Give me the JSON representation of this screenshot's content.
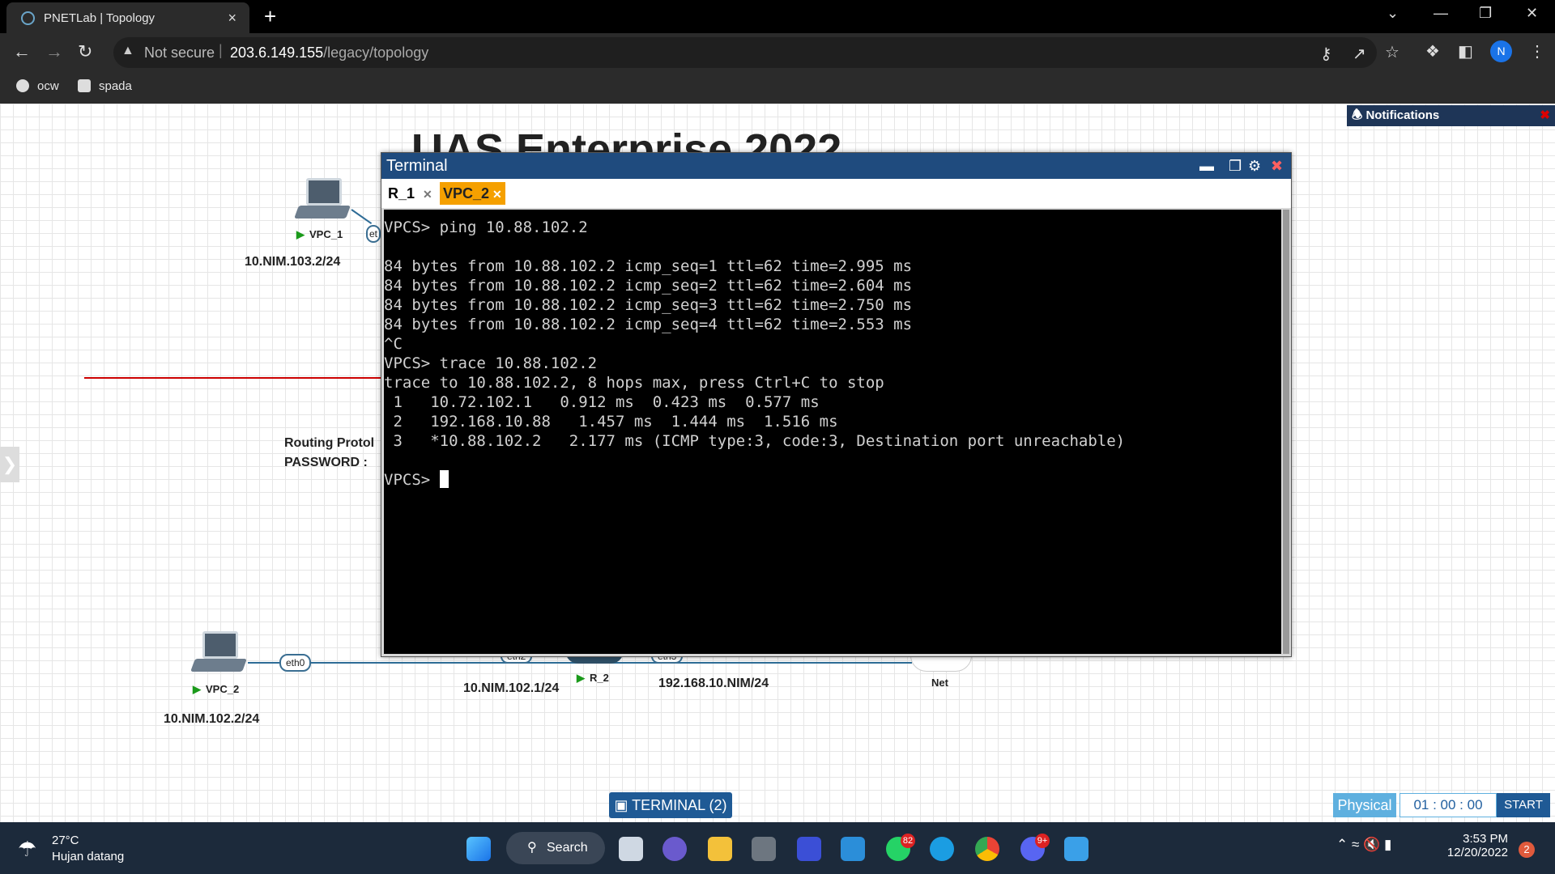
{
  "browser": {
    "tab_title": "PNETLab | Topology",
    "tab_close": "×",
    "new_tab": "+",
    "security_label": "Not secure",
    "url_host": "203.6.149.155",
    "url_path": "/legacy/topology",
    "profile_initial": "N",
    "bookmarks": [
      {
        "label": "ocw"
      },
      {
        "label": "spada"
      }
    ]
  },
  "topology": {
    "title": "UAS Enterprise 2022",
    "notifications_label": "Notifications",
    "nodes": {
      "vpc1": {
        "name": "VPC_1",
        "ip": "10.NIM.103.2/24",
        "iface": "et"
      },
      "vpc2": {
        "name": "VPC_2",
        "ip": "10.NIM.102.2/24",
        "iface": "eth0"
      },
      "r2": {
        "name": "R_2",
        "ip_eth2": "10.NIM.102.1/24",
        "ip_eth3": "192.168.10.NIM/24",
        "iface_a": "eth2",
        "iface_b": "eth3"
      },
      "net": {
        "name": "Net"
      }
    },
    "text_box": {
      "line1": "Routing Protol",
      "line2": "PASSWORD :"
    }
  },
  "terminal": {
    "window_title": "Terminal",
    "tabs": [
      {
        "label": "R_1",
        "active": false
      },
      {
        "label": "VPC_2",
        "active": true
      }
    ],
    "lines": [
      "VPCS> ping 10.88.102.2",
      "",
      "84 bytes from 10.88.102.2 icmp_seq=1 ttl=62 time=2.995 ms",
      "84 bytes from 10.88.102.2 icmp_seq=2 ttl=62 time=2.604 ms",
      "84 bytes from 10.88.102.2 icmp_seq=3 ttl=62 time=2.750 ms",
      "84 bytes from 10.88.102.2 icmp_seq=4 ttl=62 time=2.553 ms",
      "^C",
      "VPCS> trace 10.88.102.2",
      "trace to 10.88.102.2, 8 hops max, press Ctrl+C to stop",
      " 1   10.72.102.1   0.912 ms  0.423 ms  0.577 ms",
      " 2   192.168.10.88   1.457 ms  1.444 ms  1.516 ms",
      " 3   *10.88.102.2   2.177 ms (ICMP type:3, code:3, Destination port unreachable)",
      ""
    ],
    "prompt": "VPCS> "
  },
  "controls": {
    "terminal_button": "TERMINAL (2)",
    "physical_label": "Physical",
    "timer": "01 : 00 : 00",
    "start_label": "START"
  },
  "taskbar": {
    "temperature": "27°C",
    "weather": "Hujan datang",
    "search_label": "Search",
    "whatsapp_badge": "82",
    "discord_badge": "9+",
    "time": "3:53 PM",
    "date": "12/20/2022",
    "notification_count": "2"
  },
  "colors": {
    "terminal_title_bar": "#1f4b7e",
    "active_tab": "#f5a000",
    "link": "#2e6c96",
    "accent_button": "#1f5a95"
  }
}
